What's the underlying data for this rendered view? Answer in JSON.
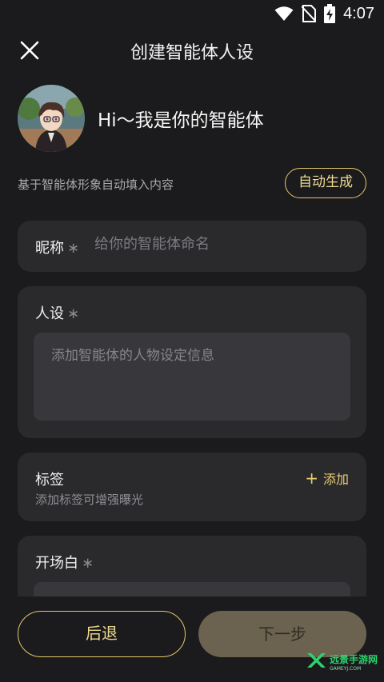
{
  "status_bar": {
    "time": "4:07",
    "icons": [
      "wifi-icon",
      "no-sim-icon",
      "battery-charging-icon"
    ]
  },
  "header": {
    "title": "创建智能体人设",
    "close_icon": "close-icon"
  },
  "intro": {
    "greeting": "Hi～我是你的智能体",
    "auto_hint": "基于智能体形象自动填入内容",
    "auto_button": "自动生成"
  },
  "form": {
    "nickname": {
      "label": "昵称",
      "required_mark": "∗",
      "placeholder": "给你的智能体命名",
      "value": ""
    },
    "persona": {
      "label": "人设",
      "required_mark": "∗",
      "placeholder": "添加智能体的人物设定信息",
      "value": ""
    },
    "tags": {
      "label": "标签",
      "hint": "添加标签可增强曝光",
      "add_label": "添加",
      "add_icon": "plus-icon"
    },
    "opening": {
      "label": "开场白",
      "required_mark": "∗"
    }
  },
  "footer": {
    "back_label": "后退",
    "next_label": "下一步"
  },
  "watermark": {
    "main": "远景手游网",
    "sub": "GAMEYJ.COM"
  },
  "colors": {
    "background": "#1b1b1d",
    "card": "#2a2a2d",
    "accent_gold": "#e5c76b",
    "next_button_disabled": "#6b6350",
    "watermark_green": "#2ad36b"
  }
}
